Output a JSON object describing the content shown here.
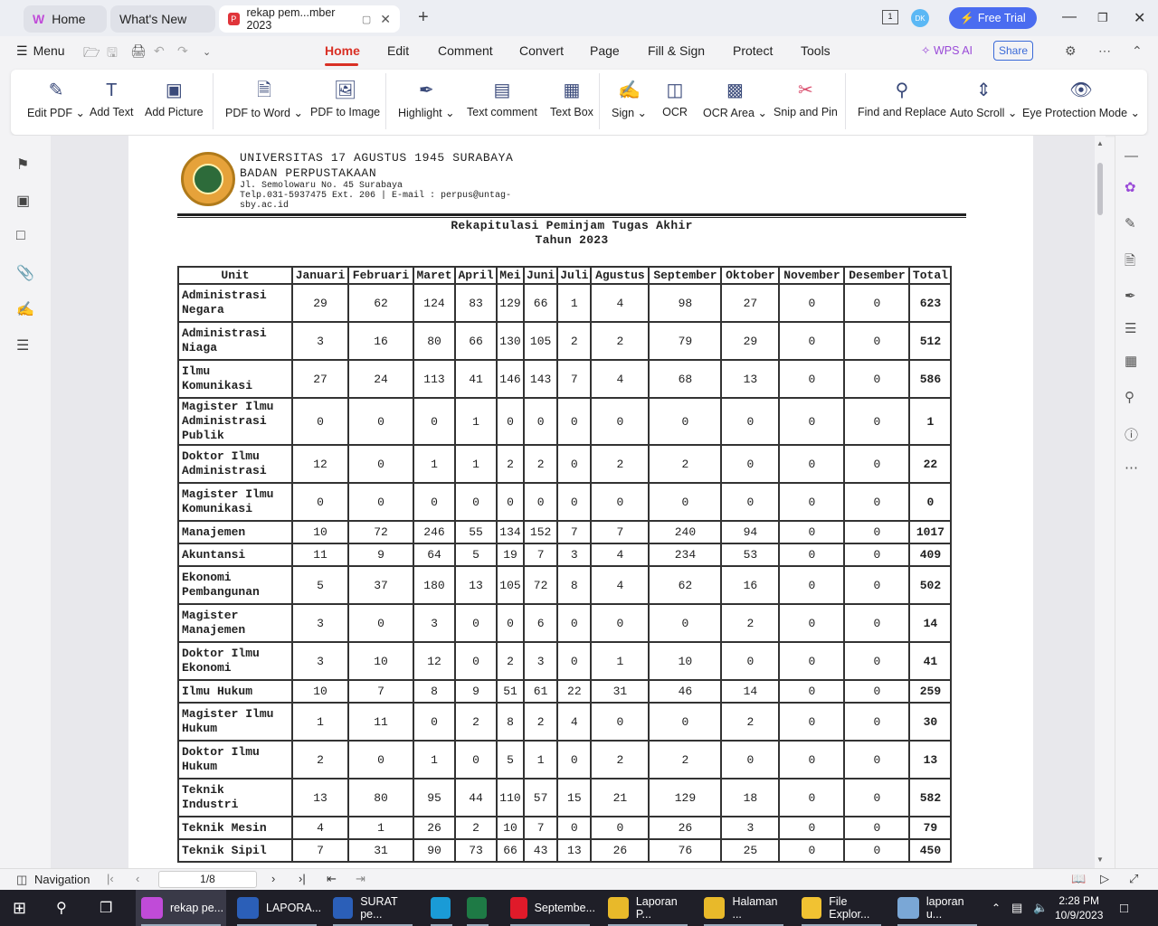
{
  "tabs": [
    {
      "label": "Home",
      "icon": "wps-logo-icon"
    },
    {
      "label": "What's New"
    },
    {
      "label": "rekap pem...mber 2023",
      "icon": "pdf-icon"
    }
  ],
  "window": {
    "free_trial": "Free Trial",
    "avatar": "DK"
  },
  "menu": {
    "menu_label": "Menu",
    "items": [
      "Home",
      "Edit",
      "Comment",
      "Convert",
      "Page",
      "Fill & Sign",
      "Protect",
      "Tools"
    ],
    "active": "Home",
    "wps_ai": "WPS AI",
    "share": "Share"
  },
  "toolbar": {
    "items": [
      {
        "label": "Edit PDF",
        "dropdown": true,
        "icon": "edit-pdf-icon"
      },
      {
        "label": "Add Text",
        "icon": "add-text-icon"
      },
      {
        "label": "Add Picture",
        "icon": "add-picture-icon"
      },
      {
        "label": "PDF to Word",
        "dropdown": true,
        "icon": "pdf-to-word-icon"
      },
      {
        "label": "PDF to Image",
        "icon": "pdf-to-image-icon"
      },
      {
        "label": "Highlight",
        "dropdown": true,
        "icon": "highlight-icon"
      },
      {
        "label": "Text comment",
        "icon": "text-comment-icon"
      },
      {
        "label": "Text Box",
        "icon": "text-box-icon"
      },
      {
        "label": "Sign",
        "dropdown": true,
        "icon": "sign-icon"
      },
      {
        "label": "OCR",
        "icon": "ocr-icon"
      },
      {
        "label": "OCR Area",
        "dropdown": true,
        "icon": "ocr-area-icon"
      },
      {
        "label": "Snip and Pin",
        "icon": "snip-pin-icon"
      },
      {
        "label": "Find and Replace",
        "icon": "find-replace-icon"
      },
      {
        "label": "Auto Scroll",
        "dropdown": true,
        "icon": "auto-scroll-icon"
      },
      {
        "label": "Eye Protection Mode",
        "dropdown": true,
        "icon": "eye-icon"
      }
    ]
  },
  "document": {
    "header": {
      "line1": "UNIVERSITAS 17 AGUSTUS 1945 SURABAYA",
      "line2": "BADAN PERPUSTAKAAN",
      "line3": "Jl. Semolowaru No. 45 Surabaya",
      "line4": "Telp.031-5937475 Ext. 206 | E-mail : perpus@untag-",
      "line5": "sby.ac.id"
    },
    "title1": "Rekapitulasi Peminjam Tugas Akhir",
    "title2": "Tahun 2023",
    "columns": [
      "Unit",
      "Januari",
      "Februari",
      "Maret",
      "April",
      "Mei",
      "Juni",
      "Juli",
      "Agustus",
      "September",
      "Oktober",
      "November",
      "Desember",
      "Total"
    ],
    "rows": [
      [
        "Administrasi\nNegara",
        "29",
        "62",
        "124",
        "83",
        "129",
        "66",
        "1",
        "4",
        "98",
        "27",
        "0",
        "0",
        "623"
      ],
      [
        "Administrasi\nNiaga",
        "3",
        "16",
        "80",
        "66",
        "130",
        "105",
        "2",
        "2",
        "79",
        "29",
        "0",
        "0",
        "512"
      ],
      [
        "Ilmu\nKomunikasi",
        "27",
        "24",
        "113",
        "41",
        "146",
        "143",
        "7",
        "4",
        "68",
        "13",
        "0",
        "0",
        "586"
      ],
      [
        "Magister Ilmu\nAdministrasi\nPublik",
        "0",
        "0",
        "0",
        "1",
        "0",
        "0",
        "0",
        "0",
        "0",
        "0",
        "0",
        "0",
        "1"
      ],
      [
        "Doktor Ilmu\nAdministrasi",
        "12",
        "0",
        "1",
        "1",
        "2",
        "2",
        "0",
        "2",
        "2",
        "0",
        "0",
        "0",
        "22"
      ],
      [
        "Magister Ilmu\nKomunikasi",
        "0",
        "0",
        "0",
        "0",
        "0",
        "0",
        "0",
        "0",
        "0",
        "0",
        "0",
        "0",
        "0"
      ],
      [
        "Manajemen",
        "10",
        "72",
        "246",
        "55",
        "134",
        "152",
        "7",
        "7",
        "240",
        "94",
        "0",
        "0",
        "1017"
      ],
      [
        "Akuntansi",
        "11",
        "9",
        "64",
        "5",
        "19",
        "7",
        "3",
        "4",
        "234",
        "53",
        "0",
        "0",
        "409"
      ],
      [
        "Ekonomi\nPembangunan",
        "5",
        "37",
        "180",
        "13",
        "105",
        "72",
        "8",
        "4",
        "62",
        "16",
        "0",
        "0",
        "502"
      ],
      [
        "Magister\nManajemen",
        "3",
        "0",
        "3",
        "0",
        "0",
        "6",
        "0",
        "0",
        "0",
        "2",
        "0",
        "0",
        "14"
      ],
      [
        "Doktor Ilmu\nEkonomi",
        "3",
        "10",
        "12",
        "0",
        "2",
        "3",
        "0",
        "1",
        "10",
        "0",
        "0",
        "0",
        "41"
      ],
      [
        "Ilmu Hukum",
        "10",
        "7",
        "8",
        "9",
        "51",
        "61",
        "22",
        "31",
        "46",
        "14",
        "0",
        "0",
        "259"
      ],
      [
        "Magister Ilmu\nHukum",
        "1",
        "11",
        "0",
        "2",
        "8",
        "2",
        "4",
        "0",
        "0",
        "2",
        "0",
        "0",
        "30"
      ],
      [
        "Doktor Ilmu\nHukum",
        "2",
        "0",
        "1",
        "0",
        "5",
        "1",
        "0",
        "2",
        "2",
        "0",
        "0",
        "0",
        "13"
      ],
      [
        "Teknik\nIndustri",
        "13",
        "80",
        "95",
        "44",
        "110",
        "57",
        "15",
        "21",
        "129",
        "18",
        "0",
        "0",
        "582"
      ],
      [
        "Teknik Mesin",
        "4",
        "1",
        "26",
        "2",
        "10",
        "7",
        "0",
        "0",
        "26",
        "3",
        "0",
        "0",
        "79"
      ],
      [
        "Teknik Sipil",
        "7",
        "31",
        "90",
        "73",
        "66",
        "43",
        "13",
        "26",
        "76",
        "25",
        "0",
        "0",
        "450"
      ]
    ]
  },
  "status": {
    "navigation": "Navigation",
    "page": "1/8"
  },
  "taskbar": {
    "items": [
      {
        "label": "rekap pe...",
        "icon": "wps-pdf-icon",
        "color": "#c04bd8"
      },
      {
        "label": "LAPORA...",
        "icon": "word-icon",
        "color": "#2b5fb8"
      },
      {
        "label": "SURAT pe...",
        "icon": "word-icon",
        "color": "#2b5fb8"
      },
      {
        "label": "",
        "icon": "edge-icon",
        "color": "#1a9bd6"
      },
      {
        "label": "",
        "icon": "excel-icon",
        "color": "#1e7a45"
      },
      {
        "label": "Septembe...",
        "icon": "opera-icon",
        "color": "#e01a2a"
      },
      {
        "label": "Laporan P...",
        "icon": "chrome-icon",
        "color": "#e8b92a"
      },
      {
        "label": "Halaman ...",
        "icon": "chrome-icon",
        "color": "#e8b92a"
      },
      {
        "label": "File Explor...",
        "icon": "folder-icon",
        "color": "#f1c232"
      },
      {
        "label": "laporan u...",
        "icon": "app-icon",
        "color": "#7aa7d6"
      }
    ],
    "time": "2:28 PM",
    "date": "10/9/2023"
  }
}
